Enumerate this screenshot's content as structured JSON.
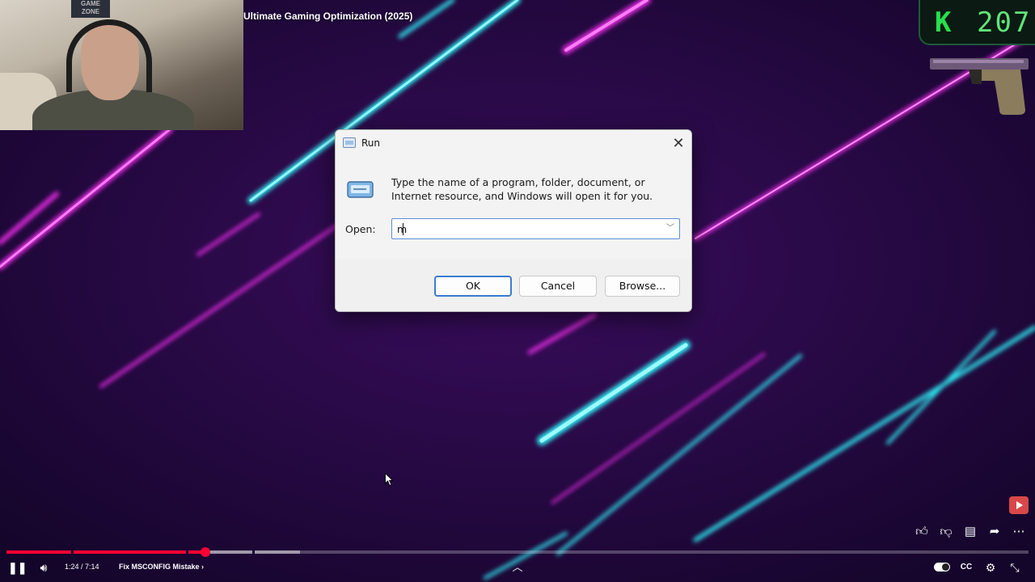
{
  "video": {
    "title": "Ultimate Gaming Optimization (2025)",
    "webcam_poster": "GAME ZONE"
  },
  "hud": {
    "kill_letter": "K",
    "kill_count": "207"
  },
  "run_dialog": {
    "title": "Run",
    "description": "Type the name of a program, folder, document, or Internet resource, and Windows will open it for you.",
    "open_label": "Open:",
    "open_value": "m",
    "buttons": {
      "ok": "OK",
      "cancel": "Cancel",
      "browse": "Browse..."
    },
    "icons": {
      "app": "run-app-icon",
      "close": "close-icon",
      "dropdown": "chevron-down-icon"
    }
  },
  "player": {
    "time": "1:24 / 7:14",
    "chapter": "Fix MSCONFIG Mistake",
    "chapter_chevron": "›",
    "progress": {
      "played_fraction": 0.195,
      "loaded_fraction": 0.287
    },
    "icons": {
      "pause": "pause-icon",
      "volume": "volume-icon",
      "like": "thumbs-up-icon",
      "dislike": "thumbs-down-icon",
      "comments": "comment-icon",
      "share": "share-icon",
      "more": "more-icon",
      "up": "chevron-up-icon",
      "autoplay": "autoplay-toggle",
      "cc": "captions-icon",
      "settings": "gear-icon",
      "exit_fullscreen": "exit-fullscreen-icon"
    }
  },
  "colors": {
    "background": "#220a3d",
    "neon_cyan": "#2ee6f0",
    "neon_magenta": "#e22ce0",
    "progress_red": "#ff0033",
    "dialog_accent": "#3c7bd0"
  }
}
